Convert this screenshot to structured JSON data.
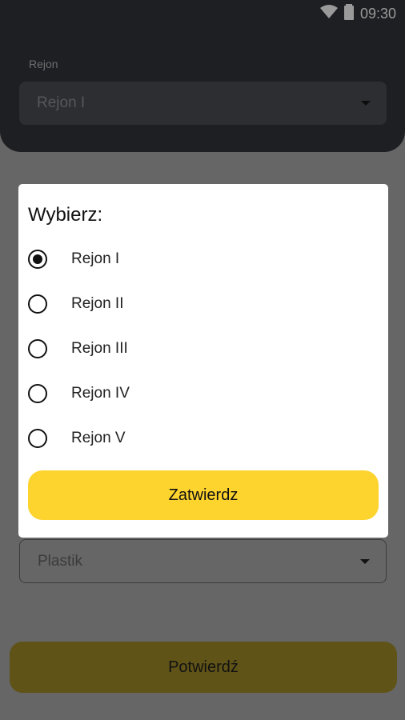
{
  "status_bar": {
    "time": "09:30",
    "icons": [
      "wifi-icon",
      "battery-icon"
    ]
  },
  "region_field": {
    "label": "Rejon",
    "value": "Rejon I"
  },
  "type_field": {
    "value": "Plastik"
  },
  "confirm_button": {
    "label": "Potwierdź"
  },
  "dialog": {
    "title": "Wybierz:",
    "options": [
      {
        "label": "Rejon I",
        "checked": true
      },
      {
        "label": "Rejon II",
        "checked": false
      },
      {
        "label": "Rejon III",
        "checked": false
      },
      {
        "label": "Rejon IV",
        "checked": false
      },
      {
        "label": "Rejon V",
        "checked": false
      }
    ],
    "submit_label": "Zatwierdz"
  },
  "colors": {
    "accent": "#fdd32e",
    "header": "#1e1f22",
    "overlay": "#666666"
  }
}
